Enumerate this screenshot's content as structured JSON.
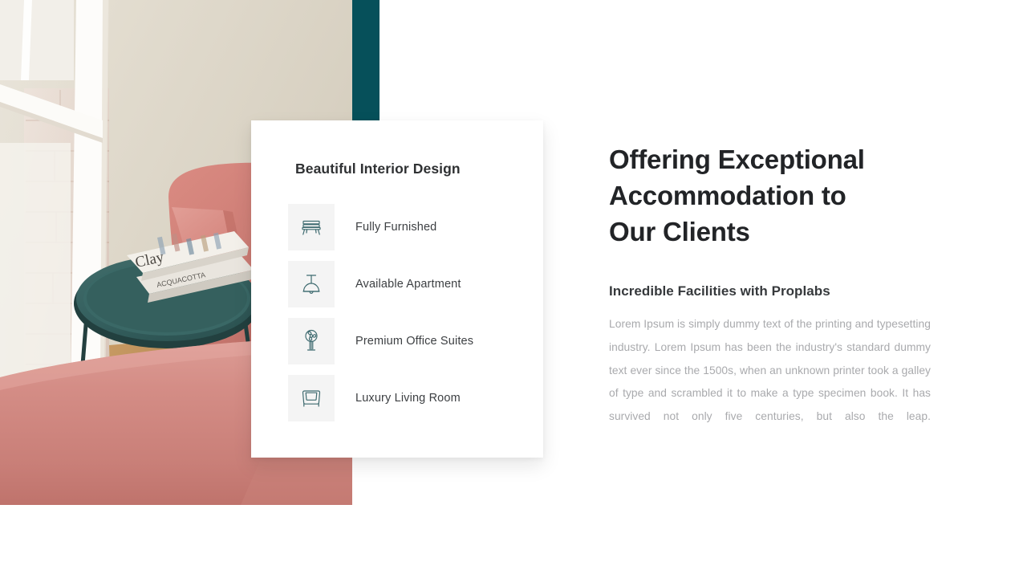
{
  "theme": {
    "page_background": "#ffffff",
    "accent_teal": "#06505a",
    "icon_stroke": "#3f6b70",
    "icon_tile_background": "#f4f4f4",
    "heading_color": "#222427",
    "body_text_color": "#a9aaad"
  },
  "photo": {
    "alt": "Interior room with pink velvet armchair beside a white window, dark teal round tray table holding two books",
    "books": [
      "Clay",
      "Acquacotta"
    ]
  },
  "card": {
    "title": "Beautiful Interior Design",
    "features": [
      {
        "icon": "bench-icon",
        "label": "Fully Furnished"
      },
      {
        "icon": "pendant-lamp-icon",
        "label": "Available Apartment"
      },
      {
        "icon": "pedestal-fan-icon",
        "label": "Premium Office Suites"
      },
      {
        "icon": "armchair-icon",
        "label": "Luxury Living Room"
      }
    ]
  },
  "content": {
    "headline_lines": [
      "Offering Exceptional",
      "Accommodation to",
      "Our Clients"
    ],
    "subheading": "Incredible Facilities with Proplabs",
    "paragraph": "Lorem Ipsum is simply dummy text of the printing and typesetting industry.  Lorem Ipsum has been the industry's standard dummy text ever since the 1500s, when an unknown printer took a galley of type and scrambled it to make a type specimen book.  It has survived not only five centuries, but also the leap."
  }
}
